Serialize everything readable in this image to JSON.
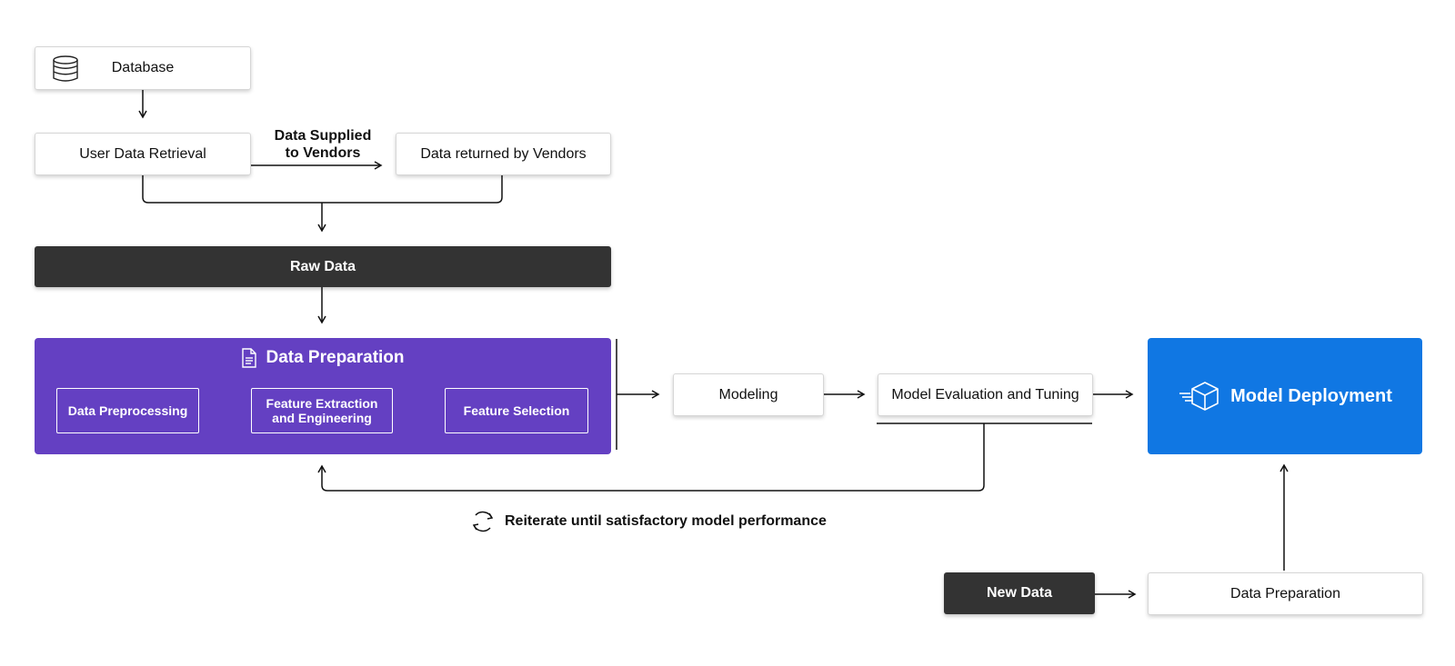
{
  "nodes": {
    "database": "Database",
    "user_data_retrieval": "User Data Retrieval",
    "data_returned_by_vendors": "Data returned by Vendors",
    "raw_data": "Raw Data",
    "data_preparation": {
      "title": "Data Preparation",
      "steps": [
        "Data Preprocessing",
        "Feature Extraction\nand Engineering",
        "Feature Selection"
      ]
    },
    "modeling": "Modeling",
    "model_evaluation": "Model Evaluation and Tuning",
    "model_deployment": "Model Deployment",
    "new_data": "New Data",
    "data_preparation_2": "Data Preparation"
  },
  "edge_labels": {
    "data_supplied": "Data Supplied\nto Vendors",
    "reiterate": "Reiterate until satisfactory model performance"
  },
  "icons": {
    "database": "database-icon",
    "document": "document-icon",
    "deploy": "deploy-cube-icon",
    "cycle": "refresh-cycle-icon"
  },
  "colors": {
    "purple": "#6440c2",
    "blue": "#1077e3",
    "dark": "#333333"
  }
}
